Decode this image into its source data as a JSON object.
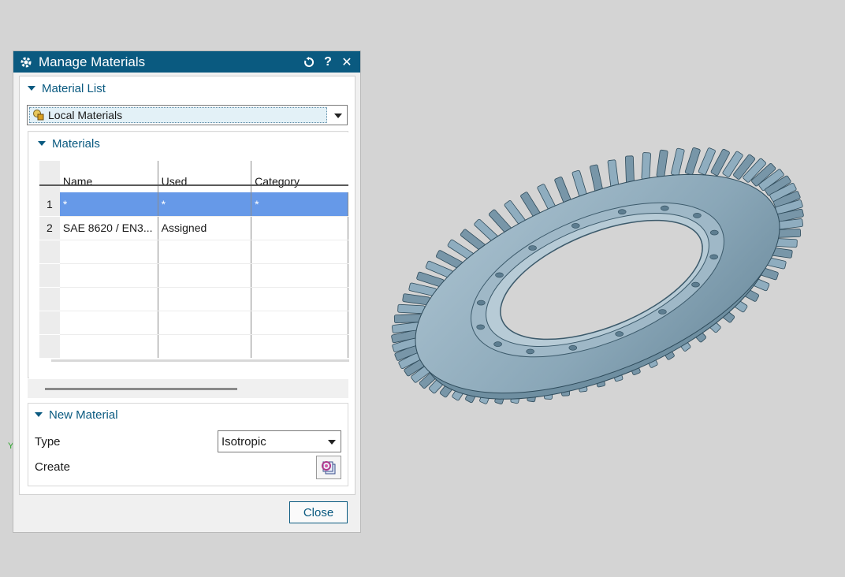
{
  "dialog": {
    "title": "Manage Materials",
    "titlebar_icons": [
      "gear-icon",
      "reset-icon",
      "help-icon",
      "close-icon"
    ],
    "help_glyph": "?",
    "close_glyph": "✕",
    "material_list": {
      "header": "Material List",
      "dropdown_value": "Local Materials"
    },
    "materials": {
      "header": "Materials",
      "columns": [
        "Name",
        "Used",
        "Category"
      ],
      "rows": [
        {
          "num": "1",
          "name": "*",
          "used": "*",
          "category": "*"
        },
        {
          "num": "2",
          "name": "SAE 8620 / EN3...",
          "used": "Assigned",
          "category": ""
        }
      ]
    },
    "new_material": {
      "header": "New Material",
      "type_label": "Type",
      "type_value": "Isotropic",
      "create_label": "Create"
    },
    "close_label": "Close"
  },
  "viewport": {
    "axis_label": "Y"
  },
  "colors": {
    "titlebar": "#0a5a80",
    "accent": "#0a5a80",
    "selection": "#6699e8",
    "gear_metal": "#8eabbd"
  }
}
